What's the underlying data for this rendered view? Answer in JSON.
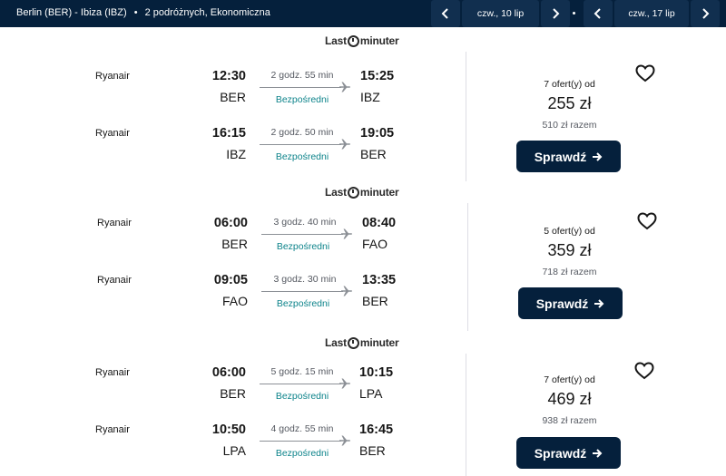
{
  "header": {
    "route": "Berlin (BER) - Ibiza (IBZ)",
    "separator": "•",
    "passengers": "2 podróżnych, Ekonomiczna",
    "outbound_date": "czw., 10 lip",
    "return_date": "czw., 17 lip"
  },
  "results": [
    {
      "provider_a": "Last",
      "provider_b": "minuter",
      "offers": "7 ofert(y) od",
      "price": "255 zł",
      "total": "510 zł razem",
      "button": "Sprawdź",
      "legs": [
        {
          "airline": "Ryanair",
          "dep_time": "12:30",
          "dep_code": "BER",
          "duration": "2 godz. 55 min",
          "arr_time": "15:25",
          "arr_code": "IBZ",
          "stops": "Bezpośredni"
        },
        {
          "airline": "Ryanair",
          "dep_time": "16:15",
          "dep_code": "IBZ",
          "duration": "2 godz. 50 min",
          "arr_time": "19:05",
          "arr_code": "BER",
          "stops": "Bezpośredni"
        }
      ]
    },
    {
      "provider_a": "Last",
      "provider_b": "minuter",
      "offers": "5 ofert(y) od",
      "price": "359 zł",
      "total": "718 zł razem",
      "button": "Sprawdź",
      "legs": [
        {
          "airline": "Ryanair",
          "dep_time": "06:00",
          "dep_code": "BER",
          "duration": "3 godz. 40 min",
          "arr_time": "08:40",
          "arr_code": "FAO",
          "stops": "Bezpośredni"
        },
        {
          "airline": "Ryanair",
          "dep_time": "09:05",
          "dep_code": "FAO",
          "duration": "3 godz. 30 min",
          "arr_time": "13:35",
          "arr_code": "BER",
          "stops": "Bezpośredni"
        }
      ]
    },
    {
      "provider_a": "Last",
      "provider_b": "minuter",
      "offers": "7 ofert(y) od",
      "price": "469 zł",
      "total": "938 zł razem",
      "button": "Sprawdź",
      "legs": [
        {
          "airline": "Ryanair",
          "dep_time": "06:00",
          "dep_code": "BER",
          "duration": "5 godz. 15 min",
          "arr_time": "10:15",
          "arr_code": "LPA",
          "stops": "Bezpośredni"
        },
        {
          "airline": "Ryanair",
          "dep_time": "10:50",
          "dep_code": "LPA",
          "duration": "4 godz. 55 min",
          "arr_time": "16:45",
          "arr_code": "BER",
          "stops": "Bezpośredni"
        }
      ]
    }
  ],
  "colors": {
    "header_bg": "#05203c",
    "button_bg": "#05203c",
    "direct_text": "#0c838a"
  },
  "icons": [
    "chevron-left-icon",
    "chevron-right-icon",
    "plane-icon",
    "arrow-right-icon",
    "heart-icon",
    "clock-icon"
  ]
}
